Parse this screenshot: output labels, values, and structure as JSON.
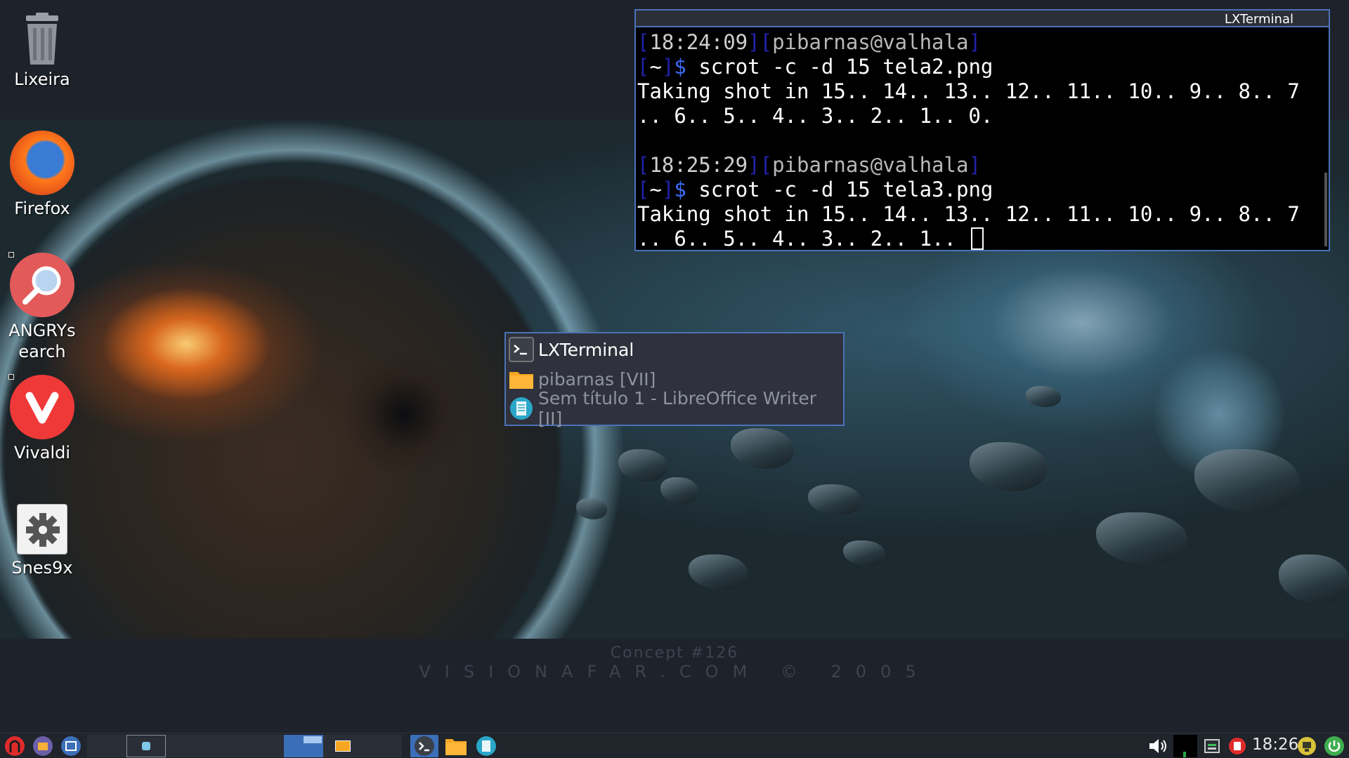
{
  "desktop": {
    "icons": [
      {
        "label": "Lixeira",
        "icon": "trash-icon"
      },
      {
        "label": "Firefox",
        "icon": "firefox-icon"
      },
      {
        "label": "ANGRYs\nearch",
        "icon": "magnifier-icon"
      },
      {
        "label": "Vivaldi",
        "icon": "vivaldi-icon"
      },
      {
        "label": "Snes9x",
        "icon": "gear-icon"
      }
    ],
    "wallpaper_credit": {
      "line1": "Concept #126",
      "line2": "VISIONAFAR.COM  © 2005"
    }
  },
  "terminal": {
    "title": "LXTerminal",
    "session1": {
      "time": "18:24:09",
      "user": "pibarnas@valhala",
      "dir": "~",
      "prompt": "$",
      "command": " scrot -c -d 15 tela2.png",
      "output1": "Taking shot in 15.. 14.. 13.. 12.. 11.. 10.. 9.. 8.. 7",
      "output2": ".. 6.. 5.. 4.. 3.. 2.. 1.. 0."
    },
    "session2": {
      "time": "18:25:29",
      "user": "pibarnas@valhala",
      "dir": "~",
      "prompt": "$",
      "command": " scrot -c -d 15 tela3.png",
      "output1": "Taking shot in 15.. 14.. 13.. 12.. 11.. 10.. 9.. 8.. 7",
      "output2": ".. 6.. 5.. 4.. 3.. 2.. 1.. "
    }
  },
  "switcher": {
    "items": [
      {
        "label": "LXTerminal",
        "icon": "terminal-icon",
        "active": true
      },
      {
        "label": "pibarnas [VII]",
        "icon": "folder-icon",
        "active": false
      },
      {
        "label": "Sem título 1 - LibreOffice Writer [II]",
        "icon": "writer-document-icon",
        "active": false
      }
    ]
  },
  "panel": {
    "clock": "18:26",
    "launchers": [
      "menu-icon",
      "file-manager-icon",
      "show-desktop-icon"
    ],
    "tray": [
      "volume-icon",
      "cpu-monitor-icon",
      "network-icon",
      "update-notifier-icon",
      "battery-icon",
      "power-icon"
    ]
  },
  "colors": {
    "accent": "#4a72b8",
    "terminal_bg": "#000000",
    "panel_bg": "#20242b",
    "prompt_dollar": "#3d6cff",
    "prompt_bracket": "#2222aa"
  }
}
